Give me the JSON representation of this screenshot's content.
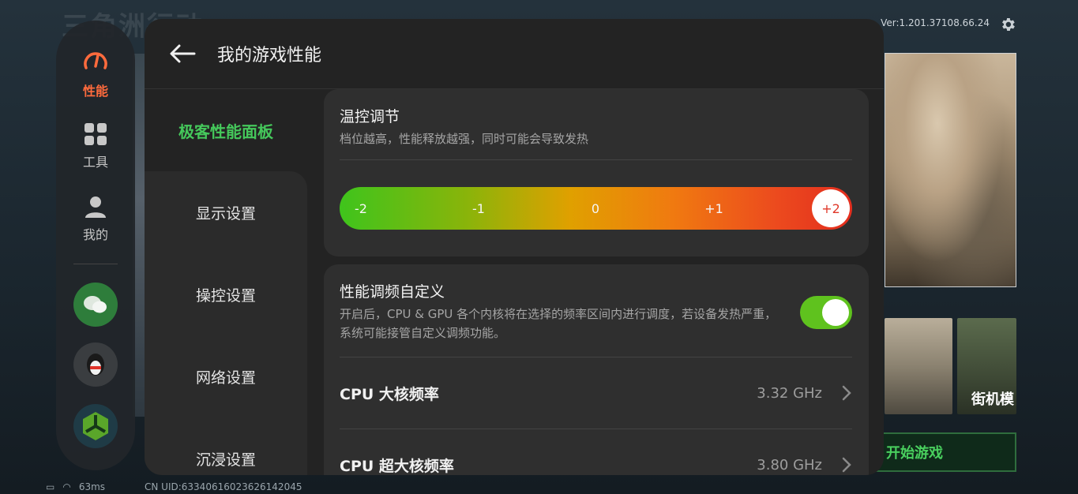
{
  "background": {
    "title": "三角洲行动",
    "version": "Ver:1.201.37108.66.24",
    "thumb_label": "街机模",
    "start_button": "开始游戏",
    "ping": "63ms",
    "uid": "CN UID:6334061602362614​2045"
  },
  "rail": {
    "items": [
      {
        "label": "性能",
        "icon": "gauge-icon"
      },
      {
        "label": "工具",
        "icon": "grid-icon"
      },
      {
        "label": "我的",
        "icon": "person-icon"
      }
    ],
    "apps": [
      "wechat-icon",
      "qq-icon",
      "game-app-icon"
    ]
  },
  "panel": {
    "title": "我的游戏性能",
    "subnav": {
      "active": "极客性能面板",
      "items": [
        "显示设置",
        "操控设置",
        "网络设置",
        "沉浸设置"
      ]
    },
    "thermal": {
      "title": "温控调节",
      "desc": "档位越高，性能释放越强，同时可能会导致发热",
      "levels": [
        "-2",
        "-1",
        "0",
        "+1",
        "+2"
      ],
      "selected": "+2"
    },
    "custom": {
      "title": "性能调频自定义",
      "desc": "开启后，CPU & GPU 各个内核将在选择的频率区间内进行调度，若设备发热严重，系统可能接管自定义调频功能。",
      "enabled": true,
      "rows": [
        {
          "label": "CPU 大核频率",
          "value": "3.32 GHz"
        },
        {
          "label": "CPU 超大核频率",
          "value": "3.80 GHz"
        }
      ]
    }
  },
  "colors": {
    "accent_green": "#45c85b",
    "accent_orange": "#ff6b3d",
    "toggle_on": "#5fc21e"
  }
}
